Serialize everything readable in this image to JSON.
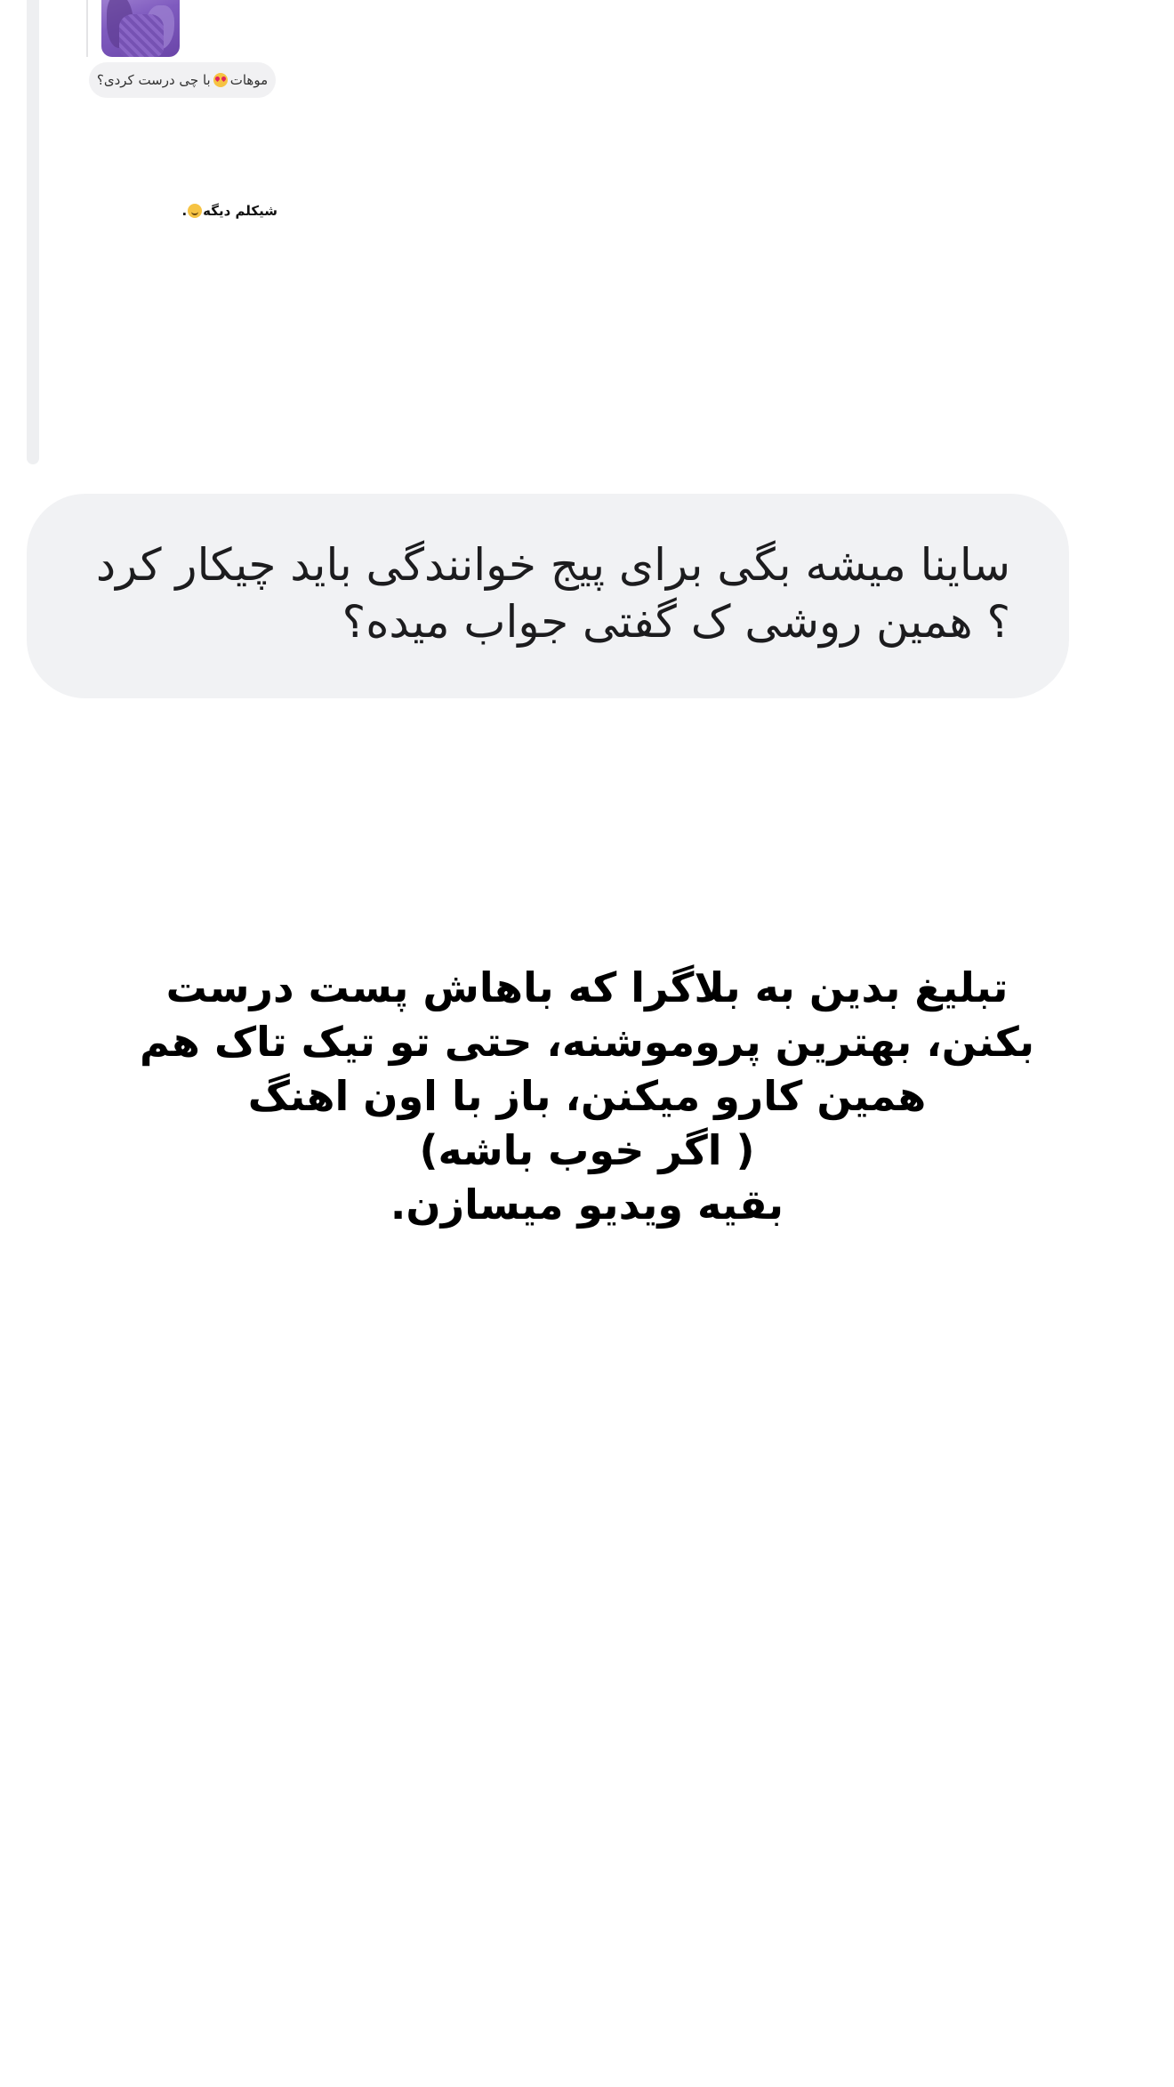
{
  "reply_context": {
    "quoted_reply": "موهات با چی درست کردی؟",
    "quoted_reply_before_emoji": "موهات",
    "quoted_reply_emoji": "heart-eyes-emoji",
    "quoted_reply_after_emoji": "با چی درست کردی؟",
    "story_sticker_text": "شیکلم دیگه",
    "story_sticker_emoji": "smile-emoji",
    "story_sticker_suffix": "."
  },
  "message": {
    "text": "ساینا میشه بگی برای پیج خوانندگی باید چیکار کرد ؟ همین روشی ک گفتی جواب میده؟"
  },
  "story": {
    "text": "تبلیغ بدین به بلاگرا که باهاش پست درست\nبکنن، بهترین پروموشنه، حتی تو تیک تاک هم\nهمین کارو میکنن، باز با اون اهنگ\n( اگر خوب باشه)\nبقیه ویدیو میسازن."
  },
  "colors": {
    "bubble": "#f1f2f4",
    "reply_line": "#eeeff1",
    "text": "#1c1c1e"
  }
}
